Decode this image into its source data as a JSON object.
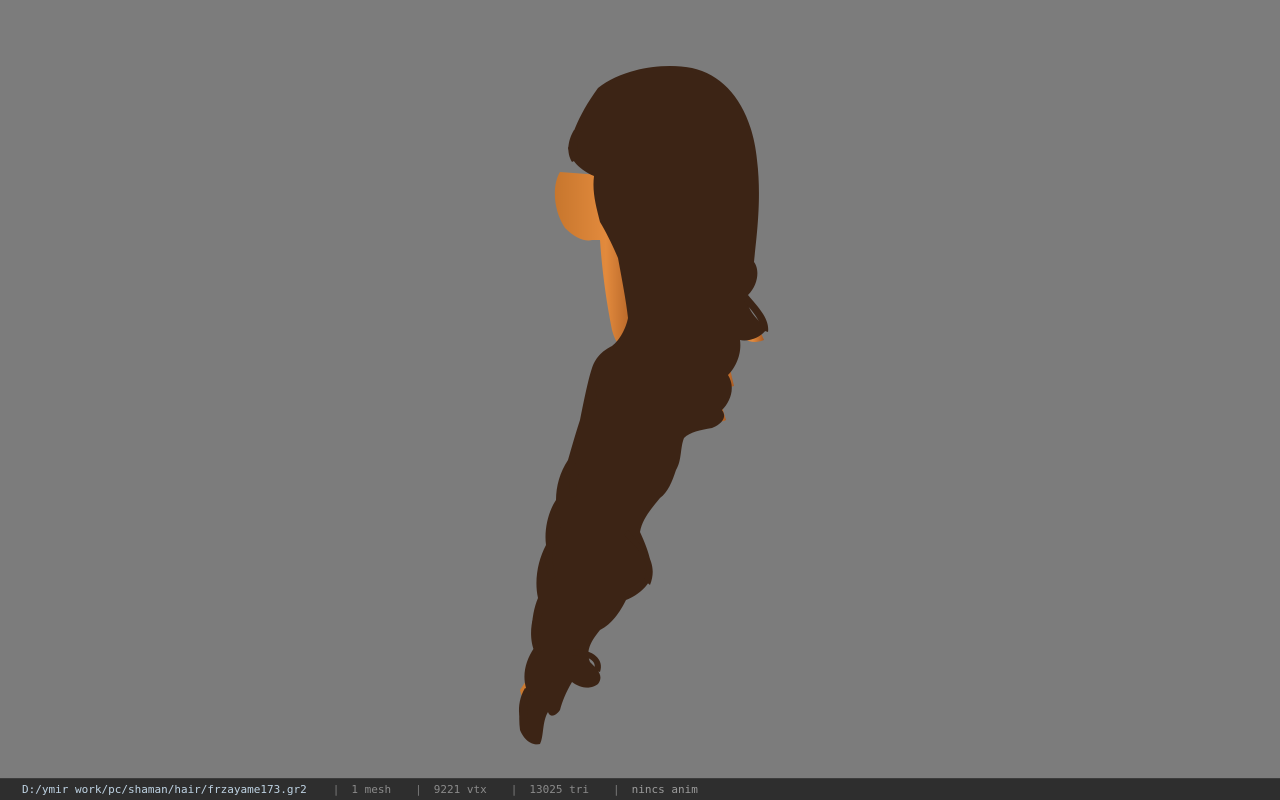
{
  "viewport": {
    "background_color": "#7c7c7c",
    "model_dark_color": "#3c2415",
    "model_light_color": "#e0853a",
    "model_mid_color": "#b86226"
  },
  "status_bar": {
    "file_path": "D:/ymir work/pc/shaman/hair/frzayame173.gr2",
    "separator": "|",
    "mesh_count": "1 mesh",
    "vertex_count": "9221 vtx",
    "triangle_count": "13025 tri",
    "anim_status": "nincs anim",
    "background_color": "#2e2e2e"
  }
}
